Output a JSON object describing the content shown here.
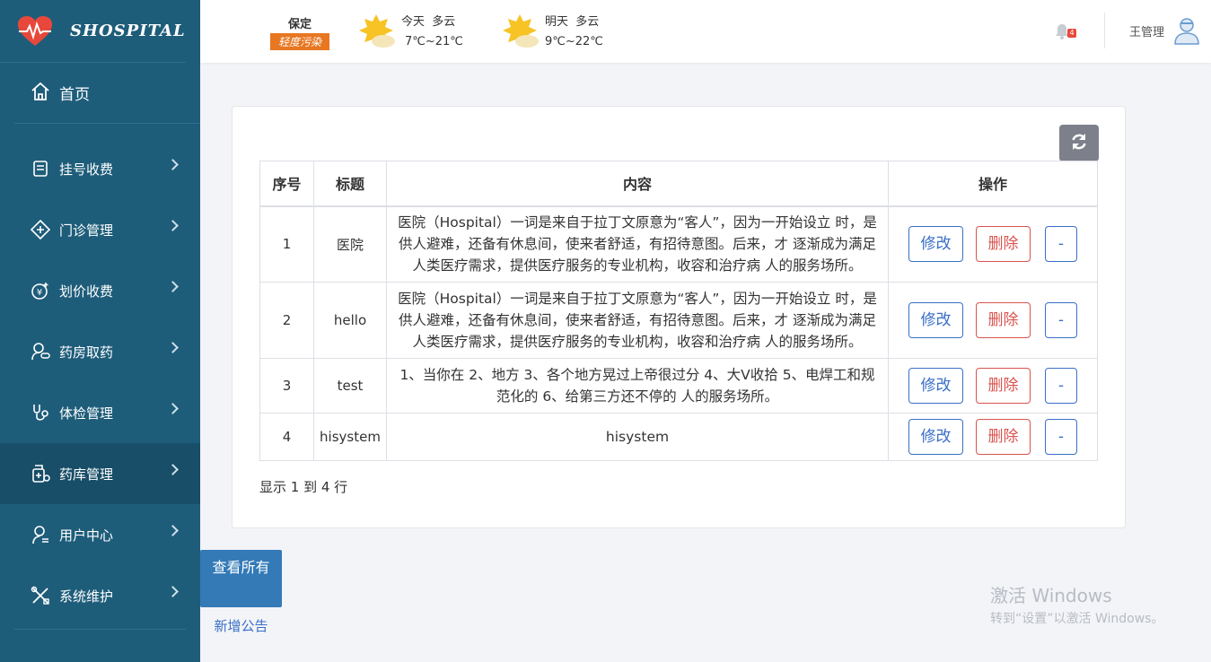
{
  "brand": {
    "name": "SHOSPITAL"
  },
  "sidebar": {
    "home": "首页",
    "items": [
      {
        "label": "挂号收费",
        "icon": "register-icon"
      },
      {
        "label": "门诊管理",
        "icon": "clinic-icon"
      },
      {
        "label": "划价收费",
        "icon": "pricing-icon"
      },
      {
        "label": "药房取药",
        "icon": "pharmacy-icon"
      },
      {
        "label": "体检管理",
        "icon": "stethoscope-icon"
      },
      {
        "label": "药库管理",
        "icon": "medicine-store-icon",
        "active": true
      },
      {
        "label": "用户中心",
        "icon": "user-icon"
      },
      {
        "label": "系统维护",
        "icon": "tools-icon"
      }
    ]
  },
  "header": {
    "city": "保定",
    "aqi": "轻度污染",
    "today": {
      "label": "今天",
      "condition": "多云",
      "temp": "7℃~21℃"
    },
    "tomorrow": {
      "label": "明天",
      "condition": "多云",
      "temp": "9℃~22℃"
    },
    "notifications": "4",
    "username": "王管理"
  },
  "table": {
    "headers": [
      "序号",
      "标题",
      "内容",
      "操作"
    ],
    "rows": [
      {
        "no": "1",
        "title": "医院",
        "content": "医院（Hospital）一词是来自于拉丁文原意为“客人”，因为一开始设立 时，是供人避难，还备有休息间，使来者舒适，有招待意图。后来，才 逐渐成为满足人类医疗需求，提供医疗服务的专业机构，收容和治疗病 人的服务场所。"
      },
      {
        "no": "2",
        "title": "hello",
        "content": "医院（Hospital）一词是来自于拉丁文原意为“客人”，因为一开始设立 时，是供人避难，还备有休息间，使来者舒适，有招待意图。后来，才 逐渐成为满足人类医疗需求，提供医疗服务的专业机构，收容和治疗病 人的服务场所。"
      },
      {
        "no": "3",
        "title": "test",
        "content": "1、当你在 2、地方 3、各个地方晃过上帝很过分 4、大V收拾 5、电焊工和规范化的 6、给第三方还不停的 人的服务场所。"
      },
      {
        "no": "4",
        "title": "hisystem",
        "content": "hisystem"
      }
    ],
    "actions": {
      "edit": "修改",
      "delete": "删除",
      "more": "-"
    },
    "summary": "显示 1 到 4 行"
  },
  "bottom": {
    "view_all": "查看所有",
    "add_notice": "新增公告"
  },
  "watermark": {
    "line1": "激活 Windows",
    "line2": "转到“设置”以激活 Windows。"
  },
  "colors": {
    "sidebar": "#1e5d7a",
    "sidebar_active": "#184e68",
    "primary": "#337ab7",
    "danger": "#d9534f",
    "aqi": "#e87722"
  }
}
